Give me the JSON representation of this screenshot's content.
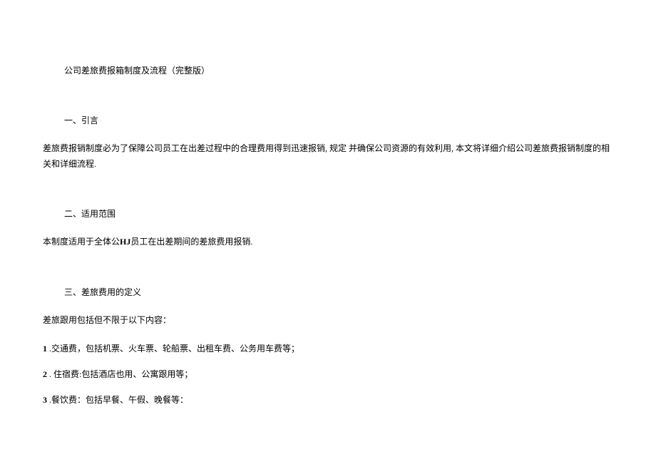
{
  "title": "公司差旅费报箱制度及流程（完整版）",
  "sections": {
    "intro": {
      "heading": "一、引言",
      "paragraph": "差旅费报销制度必为了保障公司员工在出差过程中的合理费用得到迅速报销, 规定  并确保公司资源的有效利用, 本文将详细介绍公司差旅费报销制度的相关和详细流程."
    },
    "scope": {
      "heading": "二、适用范围",
      "paragraph_prefix": "本制度适用于全体公",
      "paragraph_bold": "HJ",
      "paragraph_suffix": "员工在出差期间的差旅费用报销."
    },
    "definition": {
      "heading": "三、差旅费用的定义",
      "paragraph": "差旅跟用包括但不限于以下内容：",
      "items": [
        {
          "num": "1",
          "text": " .交通费，包括机票、火车票、轮船票、出租车费、公务用车费等；"
        },
        {
          "num": "2",
          "text": "  . 住宿费:包括酒店也用、公寓跟用等；"
        },
        {
          "num": "3",
          "text": " .餐饮费：包括早餐、午假、晚餐等："
        }
      ]
    }
  }
}
